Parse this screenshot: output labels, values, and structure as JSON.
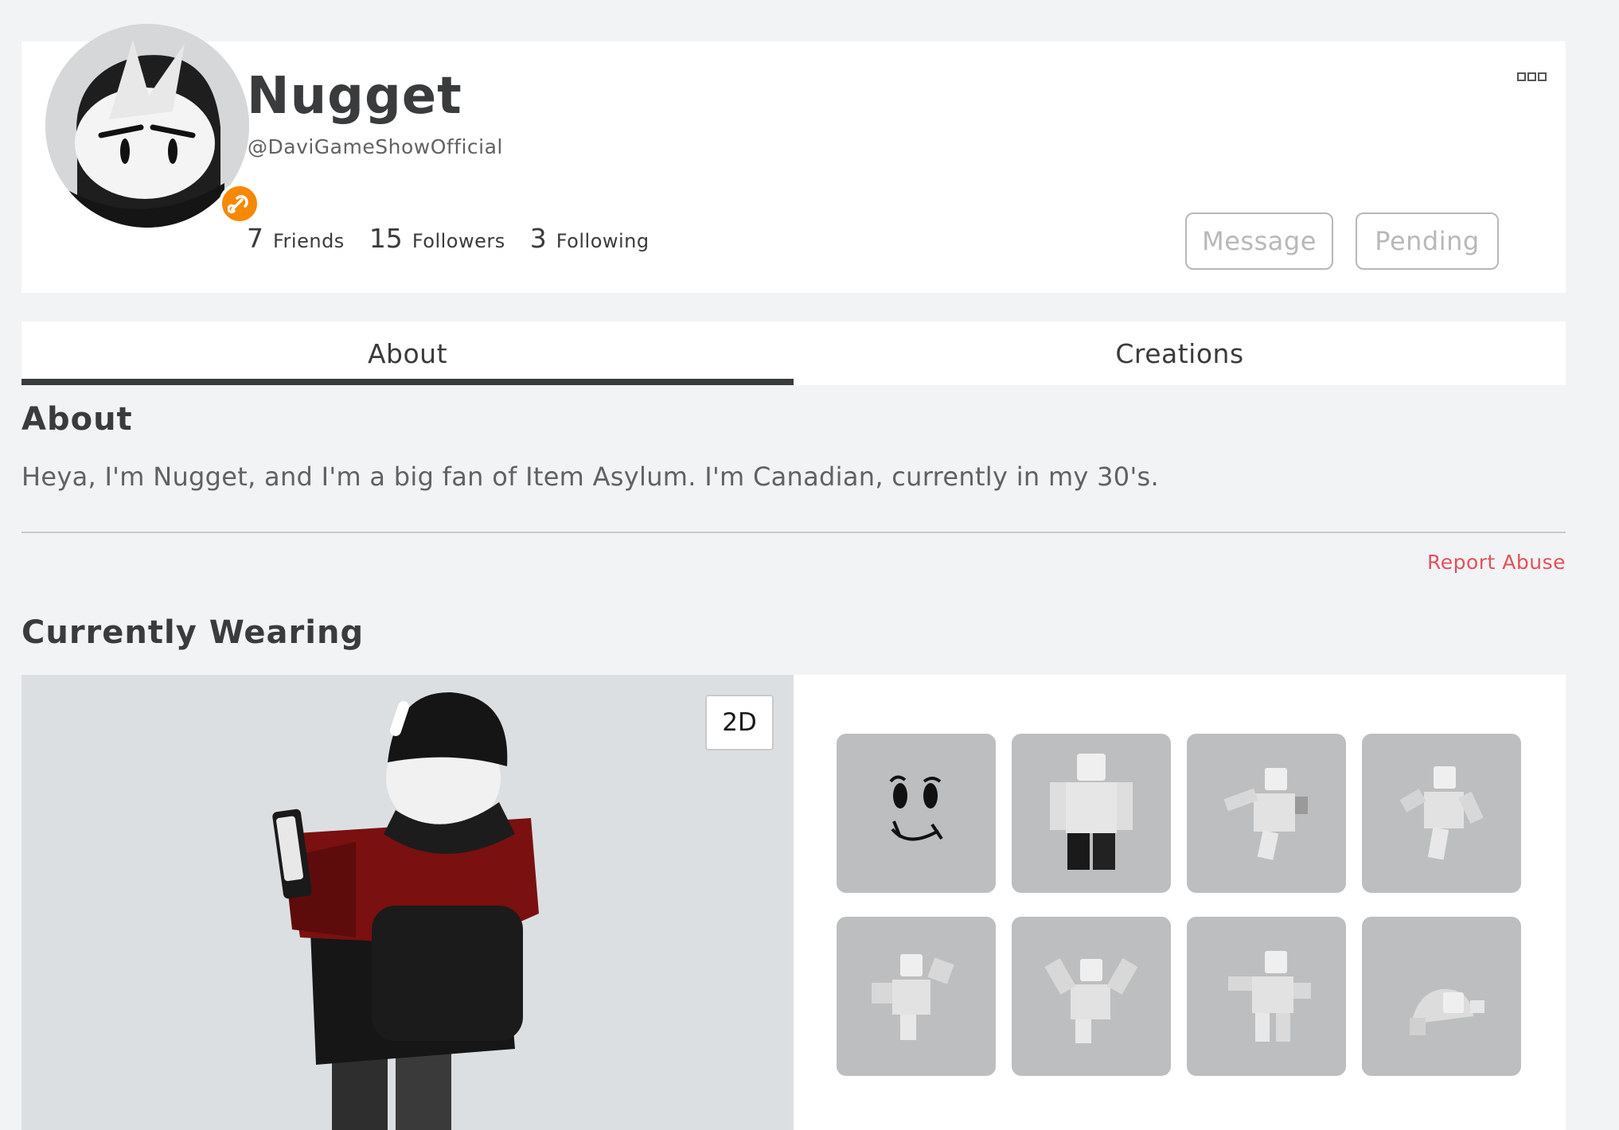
{
  "profile": {
    "display_name": "Nugget",
    "username": "@DaviGameShowOfficial",
    "badge_icon": "wrench-icon",
    "badge_color": "#f68802",
    "stats": [
      {
        "count": "7",
        "label": "Friends"
      },
      {
        "count": "15",
        "label": "Followers"
      },
      {
        "count": "3",
        "label": "Following"
      }
    ],
    "message_label": "Message",
    "pending_label": "Pending",
    "more_icon": "more-options-icon"
  },
  "tabs": [
    {
      "label": "About",
      "active": true
    },
    {
      "label": "Creations",
      "active": false
    }
  ],
  "about": {
    "title": "About",
    "text": "Heya, I'm Nugget, and I'm a big fan of Item Asylum. I'm Canadian, currently in my 30's.",
    "report_label": "Report Abuse",
    "report_color": "#e2525c"
  },
  "wearing": {
    "title": "Currently Wearing",
    "toggle_label": "2D",
    "items": [
      {
        "icon": "face-item-icon"
      },
      {
        "icon": "avatar-outfit-icon"
      },
      {
        "icon": "animation-pose-icon"
      },
      {
        "icon": "animation-pose-icon"
      },
      {
        "icon": "animation-pose-icon"
      },
      {
        "icon": "animation-pose-icon"
      },
      {
        "icon": "animation-pose-icon"
      },
      {
        "icon": "animation-pose-icon"
      }
    ]
  }
}
